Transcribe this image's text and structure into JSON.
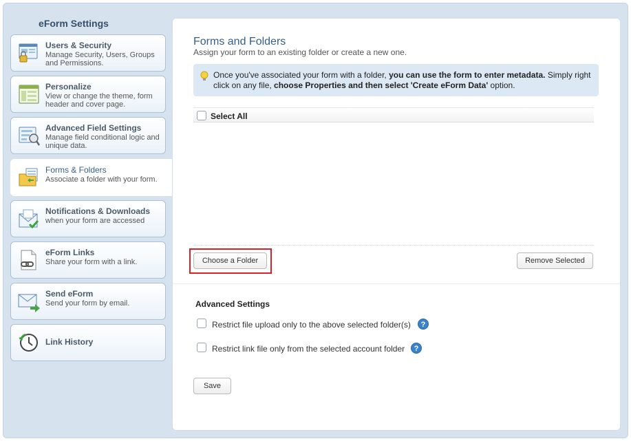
{
  "sidebar": {
    "title": "eForm Settings",
    "items": [
      {
        "label": "Users & Security",
        "desc": "Manage Security, Users, Groups and Permissions."
      },
      {
        "label": "Personalize",
        "desc": "View or change the theme, form header and cover page."
      },
      {
        "label": "Advanced Field Settings",
        "desc": "Manage field conditional logic and unique data."
      },
      {
        "label": "Forms & Folders",
        "desc": "Associate a folder with your form."
      },
      {
        "label": "Notifications & Downloads",
        "desc": "when your form are accessed"
      },
      {
        "label": "eForm Links",
        "desc": "Share your form with a link."
      },
      {
        "label": "Send eForm",
        "desc": "Send your form by email."
      },
      {
        "label": "Link History",
        "desc": ""
      }
    ]
  },
  "main": {
    "title": "Forms and Folders",
    "subtitle": "Assign your form to an existing folder or create a new one.",
    "tip": {
      "part1": "Once you've associated your form with a folder, ",
      "bold1": "you can use the form to enter metadata.",
      "part2": " Simply right click on any file, ",
      "bold2": "choose Properties and then select 'Create eForm Data'",
      "part3": " option."
    },
    "select_all": "Select All",
    "choose_folder": "Choose a Folder",
    "remove_selected": "Remove Selected",
    "advanced_title": "Advanced Settings",
    "options": [
      "Restrict file upload only to the above selected folder(s)",
      "Restrict link file only from the selected account folder"
    ],
    "help_glyph": "?",
    "save": "Save"
  },
  "colors": {
    "accent": "#355f86",
    "sidebar_bg": "#d6e3ee",
    "highlight": "#d9202b",
    "help": "#3b82c8"
  }
}
